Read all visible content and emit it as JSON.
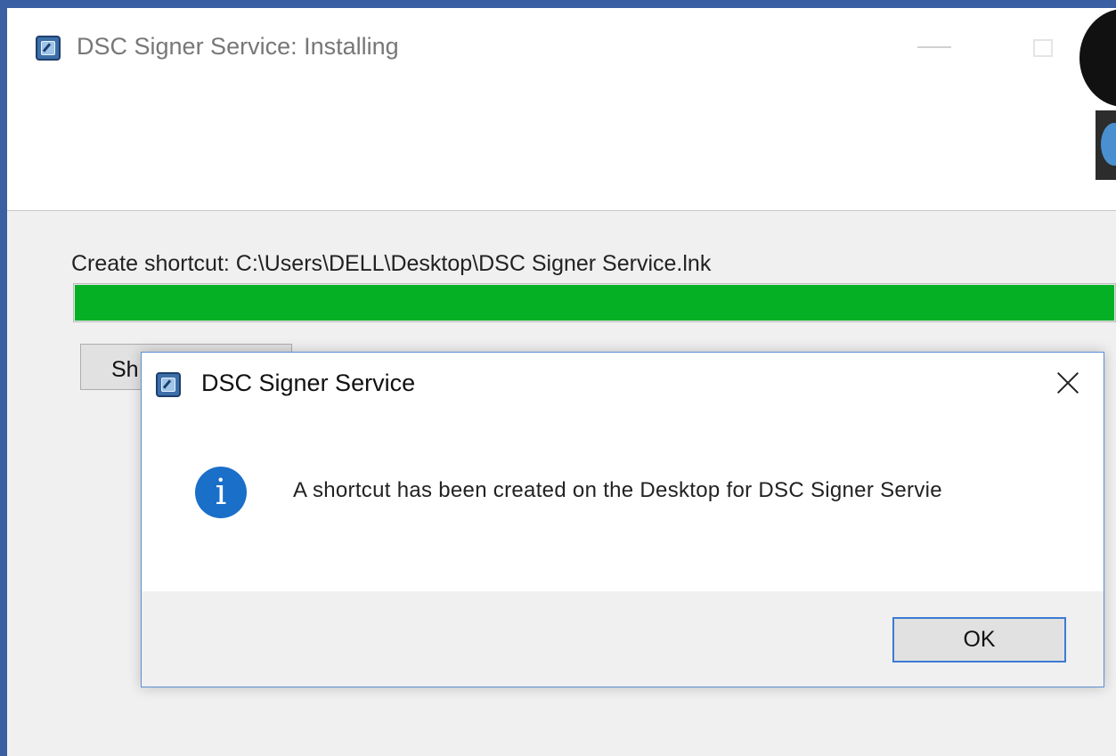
{
  "main_window": {
    "title": "DSC Signer Service: Installing",
    "status_text": "Create shortcut: C:\\Users\\DELL\\Desktop\\DSC Signer Service.lnk",
    "progress_percent": 100,
    "progress_color": "#06b025",
    "show_details_label_visible": "Sh"
  },
  "dialog": {
    "title": "DSC Signer Service",
    "icon": "info-icon",
    "icon_glyph": "i",
    "message": "A shortcut has been created on the Desktop for DSC Signer Servie",
    "ok_label": "OK"
  },
  "colors": {
    "accent": "#3d7bd4",
    "info": "#1a6fc9",
    "window_border": "#3a5fa3"
  }
}
